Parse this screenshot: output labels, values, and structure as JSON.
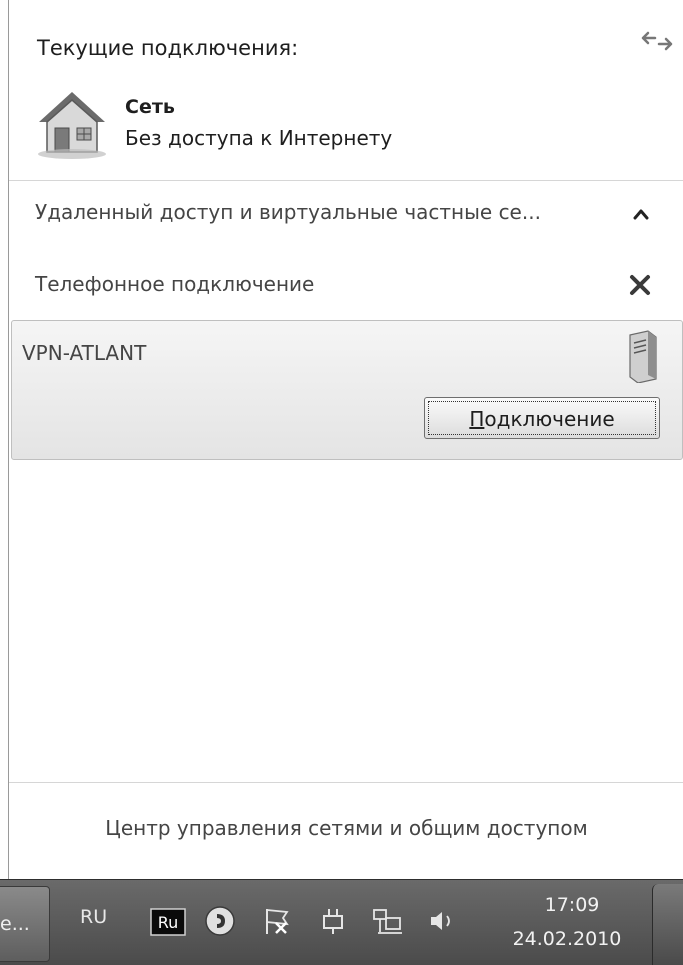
{
  "flyout": {
    "current_connections_title": "Текущие подключения:",
    "network": {
      "name": "Сеть",
      "status": "Без доступа к Интернету"
    },
    "remote_group": {
      "header": "Удаленный доступ и виртуальные частные се..."
    },
    "dialup": {
      "label": "Телефонное подключение"
    },
    "vpn": {
      "name": "VPN-ATLANT",
      "connect_accel": "П",
      "connect_rest": "одключение"
    },
    "footer_link": "Центр управления сетями и общим доступом"
  },
  "taskbar": {
    "task_label": "е...",
    "language": "RU",
    "ime_badge": "Ru",
    "clock_time": "17:09",
    "clock_date": "24.02.2010"
  },
  "icons": {
    "refresh": "refresh-icon",
    "network": "house-network-icon",
    "collapse": "chevron-up-icon",
    "close": "close-icon",
    "vpn": "server-icon"
  }
}
